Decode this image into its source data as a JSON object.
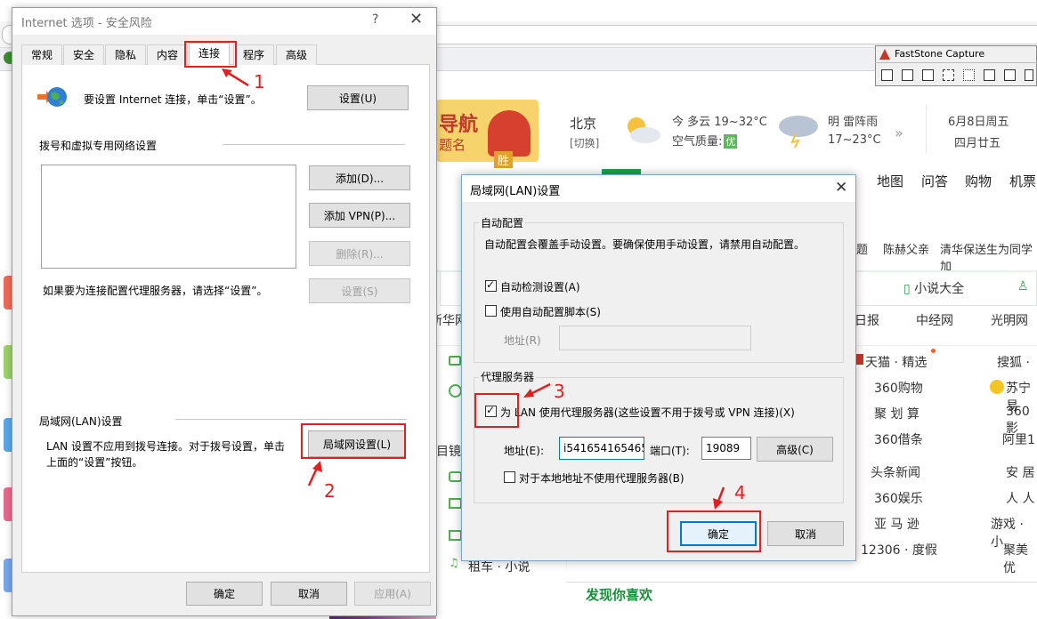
{
  "ie_options": {
    "title": "Internet 选项 - 安全风险",
    "help": "?",
    "close": "✕",
    "tabs": [
      "常规",
      "安全",
      "隐私",
      "内容",
      "连接",
      "程序",
      "高级"
    ],
    "active_tab": "连接",
    "setup_text": "要设置 Internet 连接，单击“设置”。",
    "setup_button": "设置(U)",
    "dialup_heading": "拨号和虚拟专用网络设置",
    "add_button": "添加(D)...",
    "add_vpn_button": "添加 VPN(P)...",
    "remove_button": "删除(R)...",
    "proxy_hint": "如果要为连接配置代理服务器，请选择“设置”。",
    "settings_button": "设置(S)",
    "lan_heading": "局域网(LAN)设置",
    "lan_text_1": "LAN 设置不应用到拨号连接。对于拨号设置，单击",
    "lan_text_2": "上面的“设置”按钮。",
    "lan_button": "局域网设置(L)",
    "ok": "确定",
    "cancel": "取消",
    "apply": "应用(A)"
  },
  "lan_dialog": {
    "title": "局域网(LAN)设置",
    "close": "✕",
    "auto_config_legend": "自动配置",
    "auto_config_desc": "自动配置会覆盖手动设置。要确保使用手动设置，请禁用自动配置。",
    "auto_detect_label": "自动检测设置(A)",
    "auto_detect_checked": true,
    "auto_script_label": "使用自动配置脚本(S)",
    "auto_script_checked": false,
    "address_label_disabled": "地址(R)",
    "proxy_legend": "代理服务器",
    "use_proxy_label": "为 LAN 使用代理服务器(这些设置不用于拨号或 VPN 连接)(X)",
    "use_proxy_checked": true,
    "address_label": "地址(E):",
    "address_value": "i541654165465",
    "port_label": "端口(T):",
    "port_value": "19089",
    "advanced_button": "高级(C)",
    "bypass_label": "对于本地地址不使用代理服务器(B)",
    "bypass_checked": false,
    "ok": "确定",
    "cancel": "取消"
  },
  "annotations": [
    "1",
    "2",
    "3",
    "4"
  ],
  "faststone": {
    "title": "FastStone Capture"
  },
  "background_browser": {
    "logo_text": "导航",
    "logo_sub": "题名",
    "logo_badge": "胜",
    "city": "北京",
    "switch": "[切换]",
    "weather1_line1": "今 多云   19~32°C",
    "weather1_line2": "空气质量:",
    "aqi": "优",
    "weather2_line1": "明 雷阵雨",
    "weather2_line2": "17~23°C",
    "chevron": "»",
    "date1": "6月8日周五",
    "date2": "四月廿五",
    "nav": [
      "地图",
      "问答",
      "购物",
      "机票"
    ],
    "hot": [
      "题",
      "陈赫父亲",
      "清华保送生为同学加"
    ],
    "tabs2": [
      "小说大全"
    ],
    "media": [
      "新华网",
      "日报",
      "中经网",
      "光明网"
    ],
    "links_col1": [
      "天猫 · 精选",
      "360购物",
      "聚 划 算",
      "360借条",
      "头条新闻",
      "360娱乐",
      "亚 马 逊",
      "12306 · 度假"
    ],
    "links_col2": [
      "搜狐 · ",
      "苏宁易",
      "360影",
      "阿里1",
      "安 居",
      "人 人",
      "游戏 · 小",
      "聚美优"
    ],
    "left_fragment": "目镜头",
    "bottom_item": "租车 · 小说",
    "discover": "发现你喜欢"
  },
  "colors": {
    "annotation_red": "#e02020",
    "accent_blue": "#0078d7",
    "brand_green": "#1aa34a"
  }
}
